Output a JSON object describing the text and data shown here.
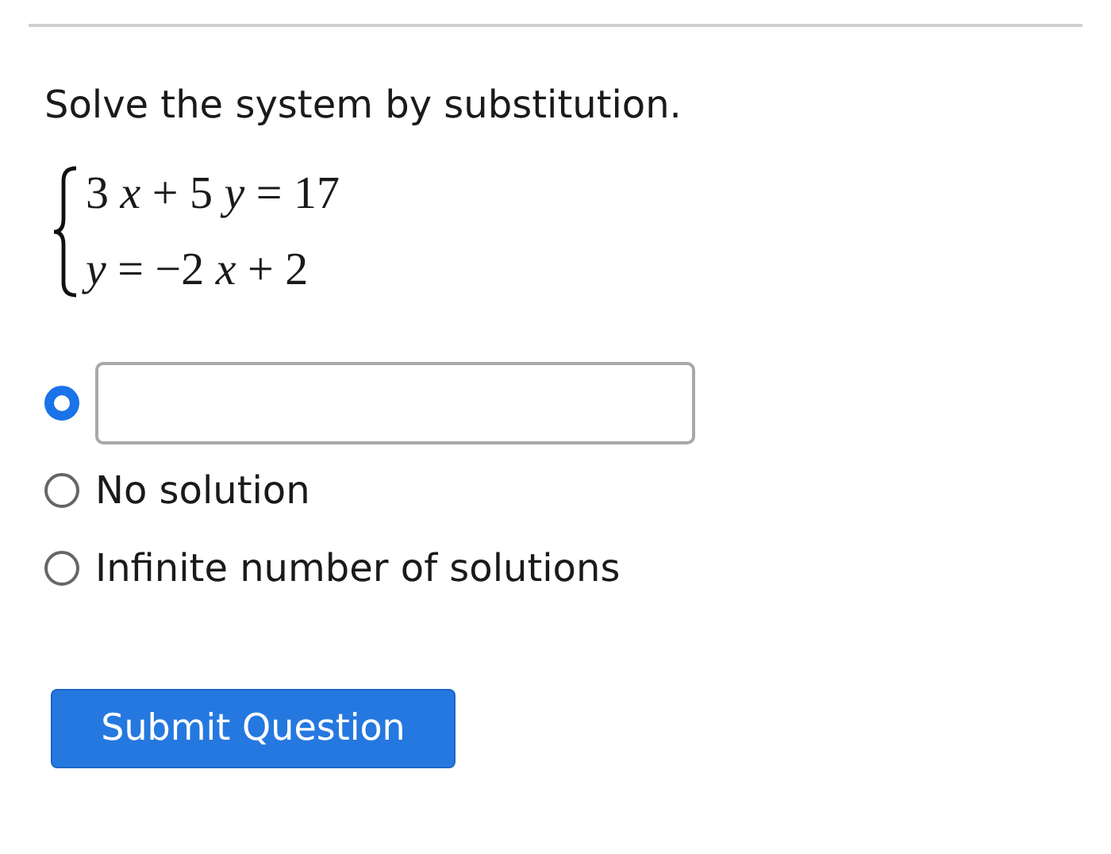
{
  "prompt": "Solve the system by substitution.",
  "equations": [
    "3 *x* + 5 *y* = 17",
    "*y* = −2 *x* + 2"
  ],
  "options": [
    {
      "kind": "input",
      "selected": true
    },
    {
      "kind": "text",
      "selected": false,
      "label": "No solution"
    },
    {
      "kind": "text",
      "selected": false,
      "label": "Infinite number of solutions"
    }
  ],
  "submit_button": "Submit Question"
}
